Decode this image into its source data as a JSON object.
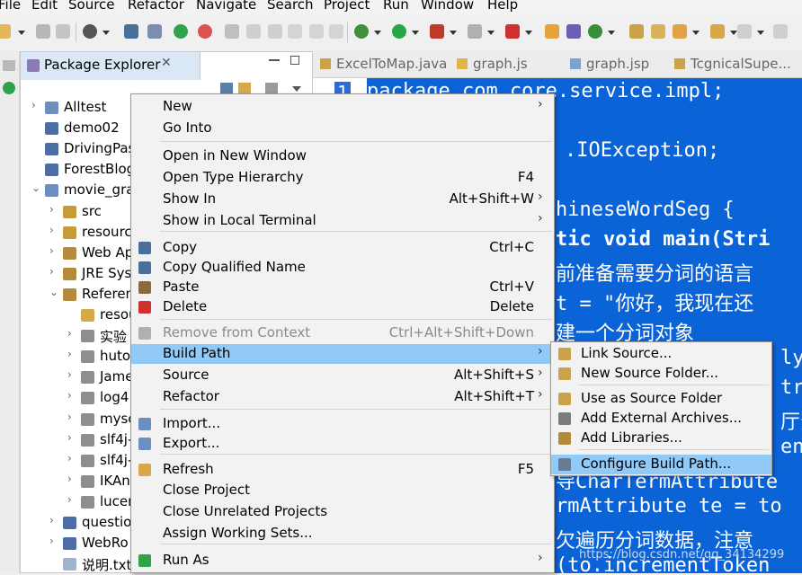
{
  "menubar": [
    "File",
    "Edit",
    "Source",
    "Refactor",
    "Navigate",
    "Search",
    "Project",
    "Run",
    "Window",
    "Help"
  ],
  "package_explorer": {
    "title": "Package Explorer",
    "close_glyph": "✕",
    "tree": [
      {
        "label": "Alltest",
        "icon": "project-icon"
      },
      {
        "label": "demo02",
        "icon": "folder-icon"
      },
      {
        "label": "DrivingPas",
        "icon": "folder-icon"
      },
      {
        "label": "ForestBlog",
        "icon": "folder-icon"
      },
      {
        "label": "movie_gra",
        "icon": "project-icon"
      },
      {
        "label": "src",
        "icon": "source-folder-icon"
      },
      {
        "label": "resourc",
        "icon": "source-folder-icon"
      },
      {
        "label": "Web Ap",
        "icon": "library-icon"
      },
      {
        "label": "JRE Sys",
        "icon": "library-icon"
      },
      {
        "label": "Referen",
        "icon": "library-icon"
      },
      {
        "label": "resou",
        "icon": "jar-folder-icon"
      },
      {
        "label": "实验",
        "icon": "jar-icon"
      },
      {
        "label": "huto",
        "icon": "jar-icon"
      },
      {
        "label": "Jame",
        "icon": "jar-icon"
      },
      {
        "label": "log4",
        "icon": "jar-icon"
      },
      {
        "label": "mysc",
        "icon": "jar-icon"
      },
      {
        "label": "slf4j-",
        "icon": "jar-icon"
      },
      {
        "label": "slf4j-",
        "icon": "jar-icon"
      },
      {
        "label": "IKAn",
        "icon": "jar-icon"
      },
      {
        "label": "lucer",
        "icon": "jar-icon"
      },
      {
        "label": "questio",
        "icon": "folder-icon"
      },
      {
        "label": "WebRo",
        "icon": "folder-icon"
      },
      {
        "label": "说明.txt",
        "icon": "text-file-icon"
      }
    ]
  },
  "editor": {
    "tabs": [
      "ExcelToMap.java",
      "graph.js",
      "graph.jsp",
      "TcgnicalSupe..."
    ],
    "line_number": "1",
    "code_lines": [
      "package com.core.service.impl;",
      "",
      ".IOException;",
      "",
      "hineseWordSeg {",
      "tic void main(Stri",
      "前准备需要分词的语言",
      " t = \"你好，我现在还",
      "建一个分词对象",
      "lys",
      "tr,",
      "厅分",
      "enS",
      "导CharTermAttribute",
      "rmAttribute te = to",
      "欠遍历分词数据，注意",
      "(to.incrementToken"
    ],
    "watermark": "https://blog.csdn.net/qq_34134299"
  },
  "context_menu": {
    "items": [
      {
        "label": "New",
        "shortcut": "",
        "submenu": true
      },
      {
        "label": "Go Into",
        "shortcut": ""
      },
      {
        "label": "Open in New Window",
        "shortcut": ""
      },
      {
        "label": "Open Type Hierarchy",
        "shortcut": "F4"
      },
      {
        "label": "Show In",
        "shortcut": "Alt+Shift+W",
        "submenu": true
      },
      {
        "label": "Show in Local Terminal",
        "shortcut": "",
        "submenu": true
      },
      {
        "label": "Copy",
        "shortcut": "Ctrl+C",
        "icon": "copy-icon"
      },
      {
        "label": "Copy Qualified Name",
        "shortcut": "",
        "icon": "copy-qualified-name-icon"
      },
      {
        "label": "Paste",
        "shortcut": "Ctrl+V",
        "icon": "paste-icon"
      },
      {
        "label": "Delete",
        "shortcut": "Delete",
        "icon": "delete-icon"
      },
      {
        "label": "Remove from Context",
        "shortcut": "Ctrl+Alt+Shift+Down",
        "icon": "remove-context-icon",
        "disabled": true
      },
      {
        "label": "Build Path",
        "shortcut": "",
        "submenu": true,
        "highlighted": true
      },
      {
        "label": "Source",
        "shortcut": "Alt+Shift+S",
        "submenu": true
      },
      {
        "label": "Refactor",
        "shortcut": "Alt+Shift+T",
        "submenu": true
      },
      {
        "label": "Import...",
        "shortcut": "",
        "icon": "import-icon"
      },
      {
        "label": "Export...",
        "shortcut": "",
        "icon": "export-icon"
      },
      {
        "label": "Refresh",
        "shortcut": "F5",
        "icon": "refresh-icon"
      },
      {
        "label": "Close Project",
        "shortcut": ""
      },
      {
        "label": "Close Unrelated Projects",
        "shortcut": ""
      },
      {
        "label": "Assign Working Sets...",
        "shortcut": ""
      },
      {
        "label": "Run As",
        "shortcut": "",
        "icon": "run-icon",
        "submenu": true
      }
    ],
    "submenu_glyph": "›"
  },
  "build_path_submenu": {
    "items": [
      {
        "label": "Link Source...",
        "icon": "link-source-icon"
      },
      {
        "label": "New Source Folder...",
        "icon": "new-source-folder-icon"
      },
      {
        "label": "Use as Source Folder",
        "icon": "use-source-folder-icon"
      },
      {
        "label": "Add External Archives...",
        "icon": "external-archive-icon"
      },
      {
        "label": "Add Libraries...",
        "icon": "add-library-icon"
      },
      {
        "label": "Configure Build Path...",
        "icon": "configure-build-path-icon",
        "highlighted": true
      }
    ]
  },
  "colors": {
    "highlight": "#91c9f7",
    "editor_selection": "#0b63d8",
    "view_tab": "#dae7f5"
  }
}
